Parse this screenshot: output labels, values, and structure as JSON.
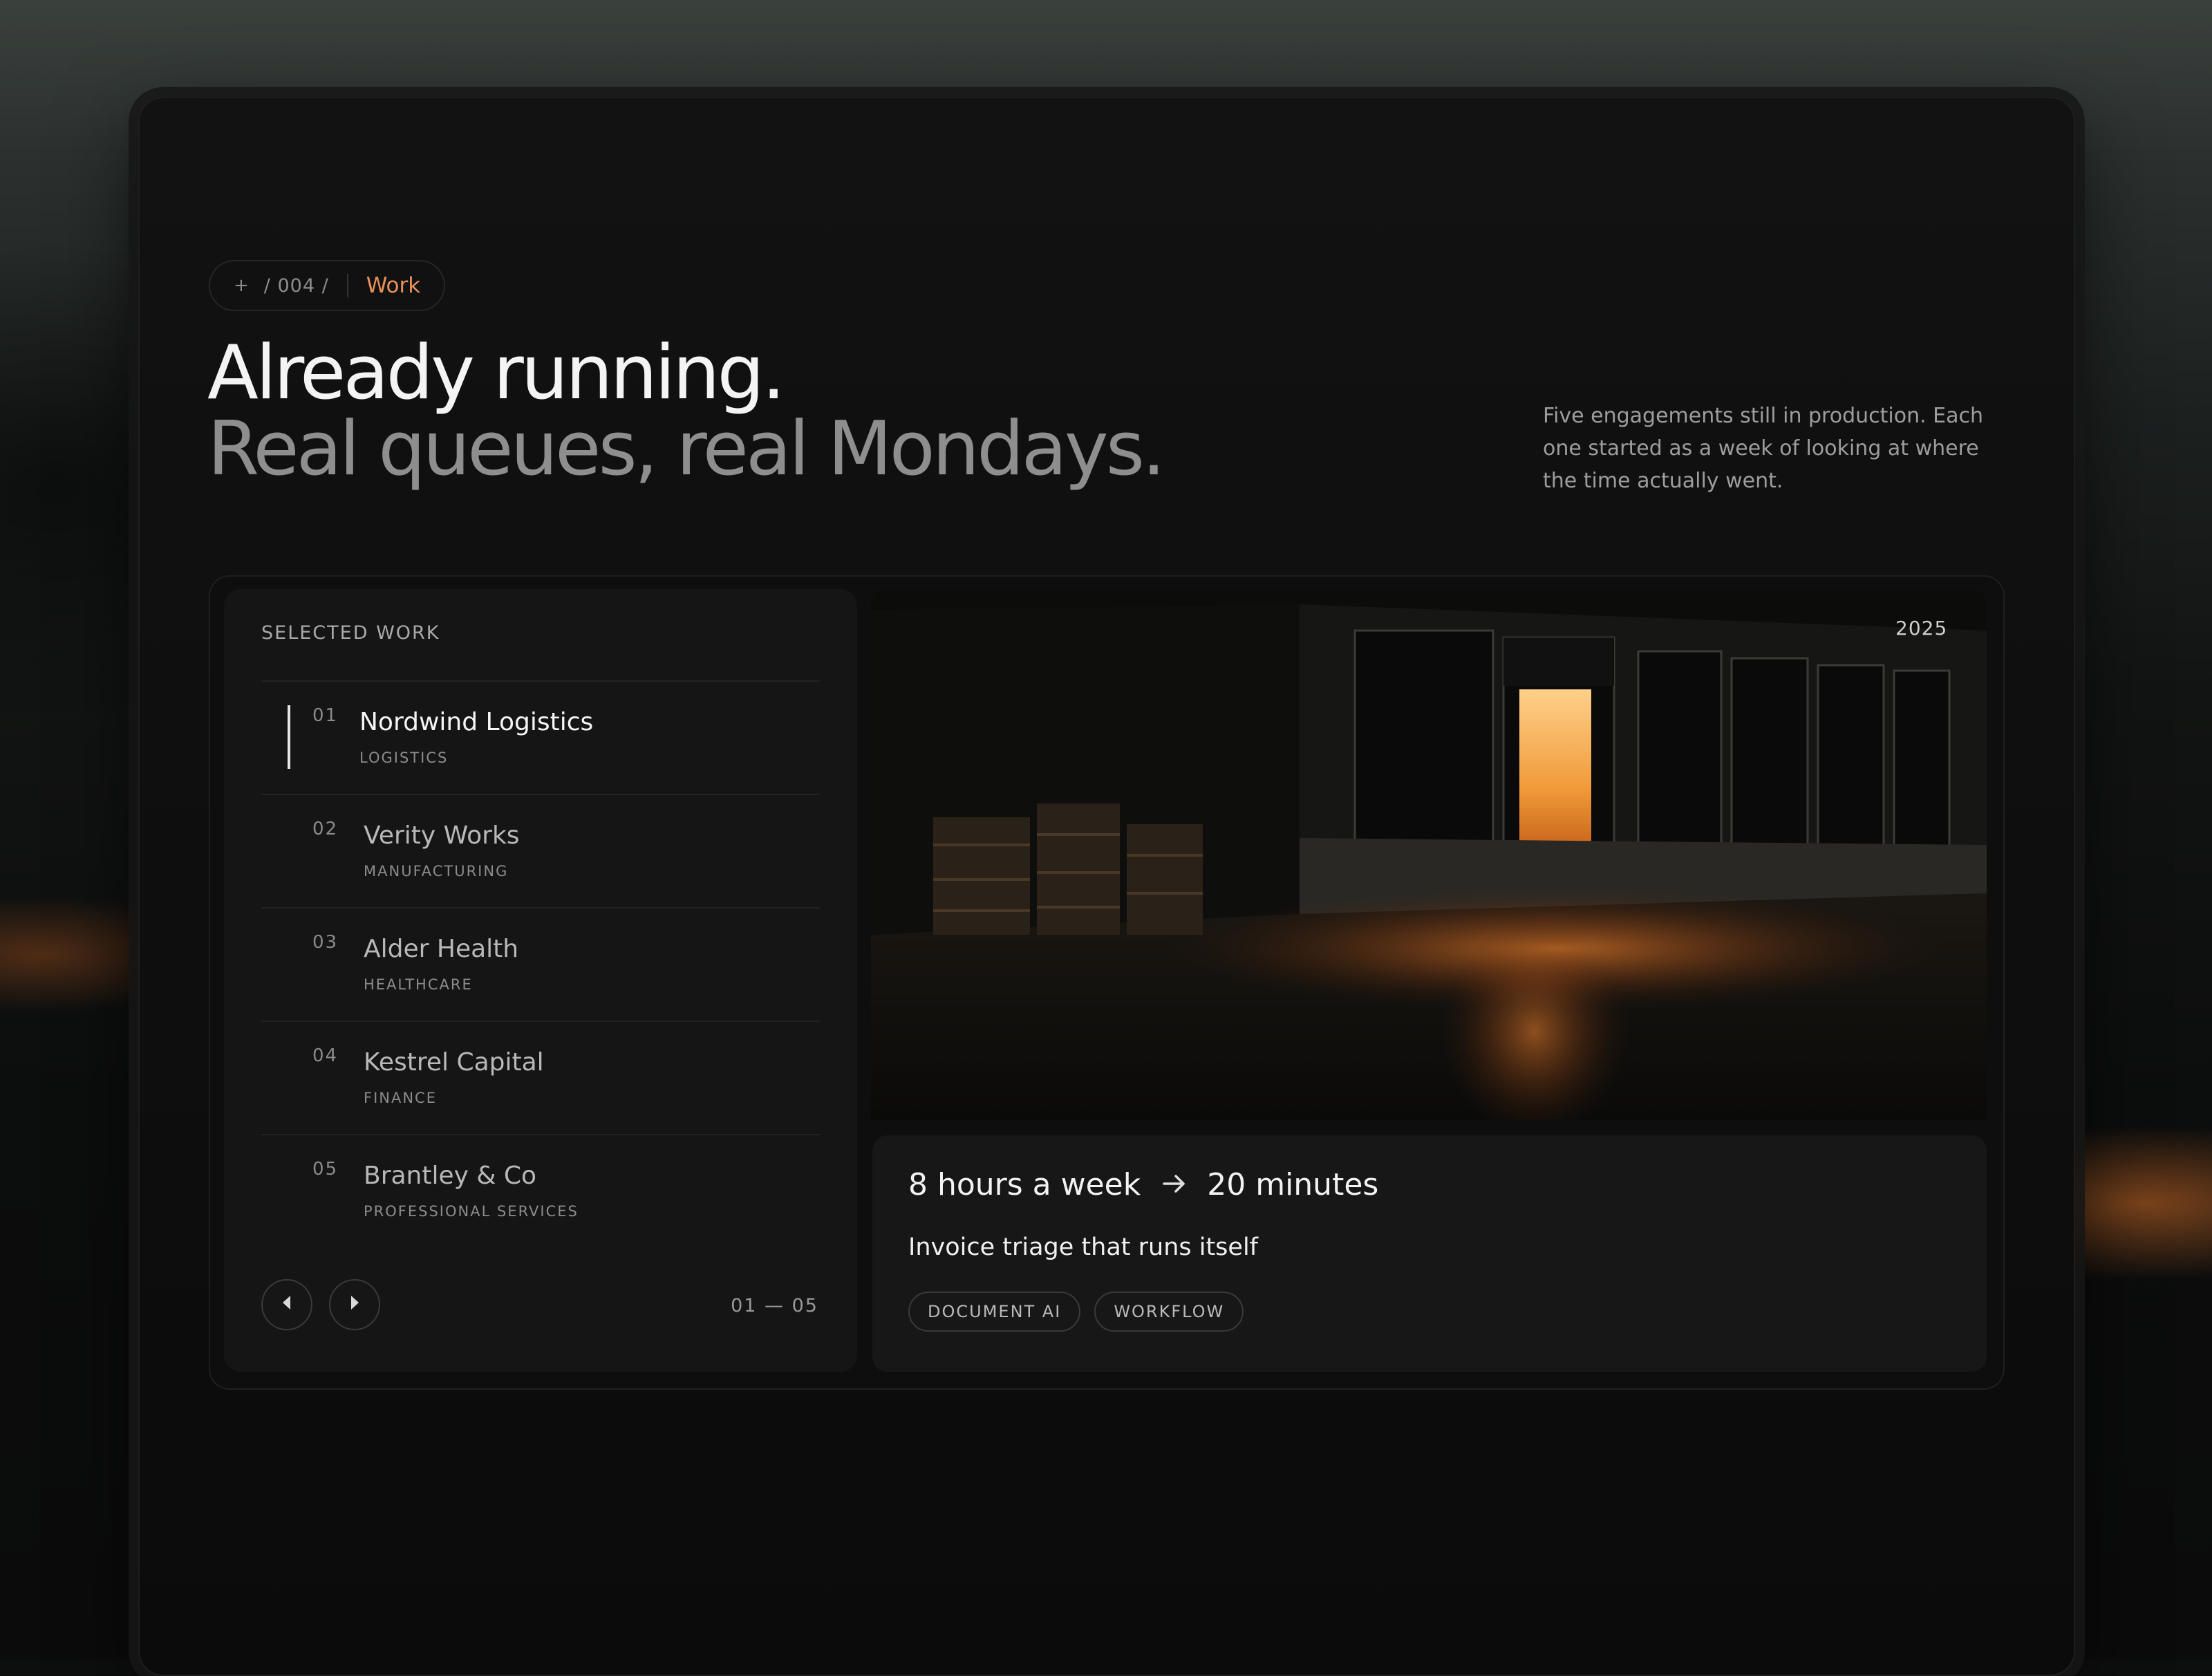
{
  "breadcrumb": {
    "plus": "+",
    "section_number": "/ 004 /",
    "section": "Work"
  },
  "hero": {
    "headline": "Already running.",
    "subheadline": "Real queues, real Mondays.",
    "intro": "Five engagements still in production. Each one started as a week of looking at where the time actually went."
  },
  "work_list": {
    "title": "SELECTED WORK",
    "items": [
      {
        "number": "01",
        "name": "Nordwind Logistics",
        "sector": "LOGISTICS",
        "active": true
      },
      {
        "number": "02",
        "name": "Verity Works",
        "sector": "MANUFACTURING",
        "active": false
      },
      {
        "number": "03",
        "name": "Alder Health",
        "sector": "HEALTHCARE",
        "active": false
      },
      {
        "number": "04",
        "name": "Kestrel Capital",
        "sector": "FINANCE",
        "active": false
      },
      {
        "number": "05",
        "name": "Brantley & Co",
        "sector": "PROFESSIONAL SERVICES",
        "active": false
      }
    ],
    "prev_icon": "chevron-left-icon",
    "next_icon": "chevron-right-icon",
    "counter": "01 — 05"
  },
  "feature": {
    "year": "2025",
    "image": "warehouse-loading-dock-at-night",
    "metric_from": "8 hours a week",
    "metric_arrow_icon": "arrow-right-icon",
    "metric_to": "20 minutes",
    "project": "Invoice triage that runs itself",
    "tags": [
      "DOCUMENT AI",
      "WORKFLOW"
    ]
  },
  "colors": {
    "accent": "#e9925a",
    "background": "#0f0f0f",
    "text_primary": "#f4f4f4",
    "text_muted": "#8e8e8e"
  }
}
